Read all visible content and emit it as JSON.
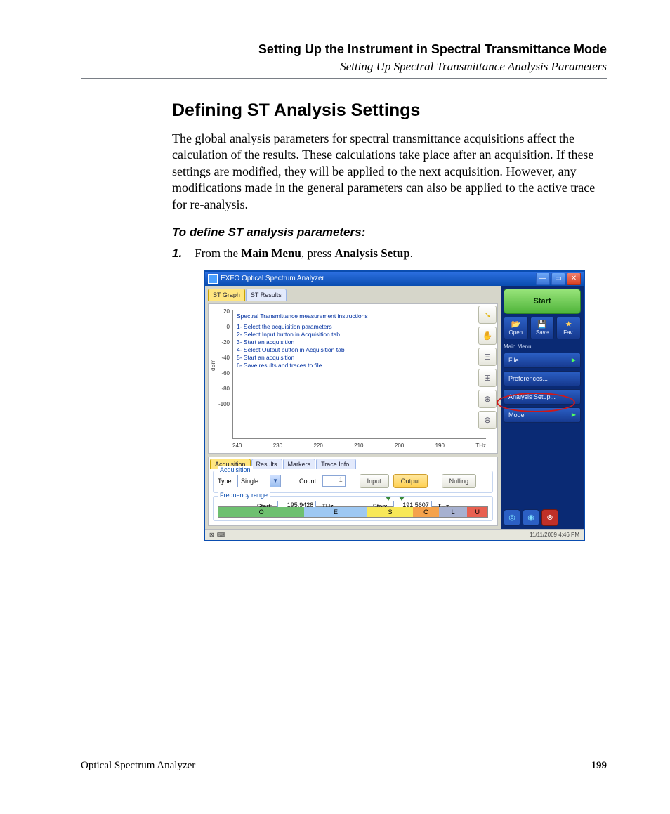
{
  "header": {
    "title": "Setting Up the Instrument in Spectral Transmittance Mode",
    "subtitle": "Setting Up Spectral Transmittance Analysis Parameters"
  },
  "section_title": "Defining ST Analysis Settings",
  "paragraph": "The global analysis parameters for spectral transmittance acquisitions affect the calculation of the results. These calculations take place after an acquisition. If these settings are modified, they will be applied to the next acquisition. However, any modifications made in the general parameters can also be applied to the active trace for re-analysis.",
  "sub_heading": "To define ST analysis parameters:",
  "step": {
    "num": "1.",
    "pre": "From the ",
    "b1": "Main Menu",
    "mid": ", press ",
    "b2": "Analysis Setup",
    "post": "."
  },
  "footer": {
    "left": "Optical Spectrum Analyzer",
    "right": "199"
  },
  "app": {
    "title": "EXFO Optical Spectrum Analyzer",
    "win": {
      "min": "—",
      "max": "▭",
      "close": "✕"
    },
    "top_tabs": {
      "t1": "ST Graph",
      "t2": "ST Results"
    },
    "graph": {
      "ylabel": "dBm",
      "yticks": {
        "y0": "20",
        "y1": "0",
        "y2": "-20",
        "y3": "-40",
        "y4": "-60",
        "y5": "-80",
        "y6": "-100"
      },
      "xticks": {
        "x0": "240",
        "x1": "230",
        "x2": "220",
        "x3": "210",
        "x4": "200",
        "x5": "190",
        "x6": "THz"
      },
      "instr_title": "Spectral Transmittance measurement instructions",
      "instr": {
        "l1": "1- Select the acquisition parameters",
        "l2": "2- Select Input button in Acquisition tab",
        "l3": "3- Start an acquisition",
        "l4": "4- Select Output button in Acquisition tab",
        "l5": "5- Start an acquisition",
        "l6": "6- Save results and traces to file"
      },
      "tools": {
        "arrow": "↘",
        "hand": "✋",
        "zoomy": "⊟",
        "zoomx": "⊞",
        "zoomin": "⊕",
        "zoomout": "⊖"
      }
    },
    "lower_tabs": {
      "t1": "Acquisition",
      "t2": "Results",
      "t3": "Markers",
      "t4": "Trace Info."
    },
    "acq": {
      "legend": "Acquisition",
      "type_label": "Type:",
      "type_value": "Single",
      "count_label": "Count:",
      "count_value": "1",
      "btn_input": "Input",
      "btn_output": "Output",
      "btn_nulling": "Nulling"
    },
    "freq": {
      "legend": "Frequency range",
      "start_label": "Start:",
      "start_value": "195.9428",
      "start_unit": "THz",
      "stop_label": "Stop:",
      "stop_value": "191.5607",
      "stop_unit": "THz",
      "bands": {
        "o": "O",
        "e": "E",
        "s": "S",
        "c": "C",
        "l": "L",
        "u": "U"
      }
    },
    "right": {
      "start": "Start",
      "open": "Open",
      "save": "Save",
      "fav": "Fav.",
      "menu_label": "Main Menu",
      "file": "File",
      "prefs": "Preferences...",
      "analysis_setup": "Analysis Setup...",
      "mode": "Mode",
      "arrow": "▶",
      "icons": {
        "open": "📂",
        "save": "💾",
        "fav": "★"
      },
      "status": {
        "a": "◎",
        "b": "◉",
        "c": "⊗"
      }
    },
    "statusbar": {
      "icons": "⊠ ⌨",
      "time": "11/11/2009 4:46 PM"
    }
  }
}
